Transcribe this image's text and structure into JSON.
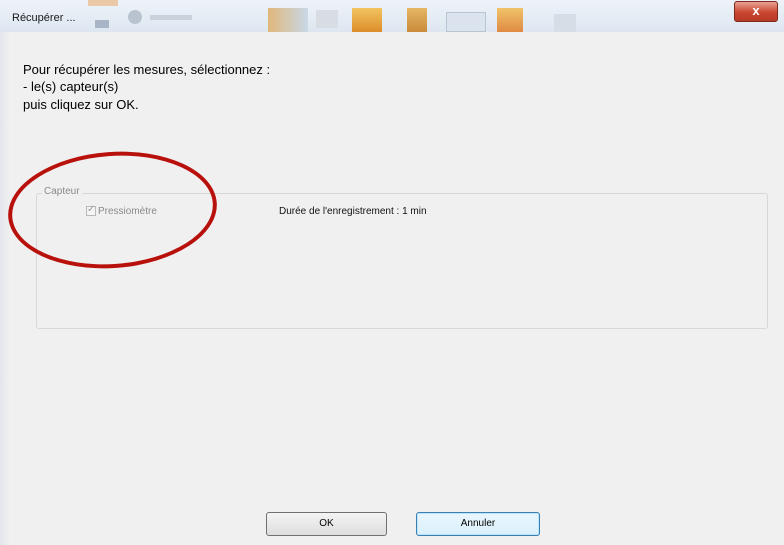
{
  "window": {
    "title": "Récupérer ...",
    "close_label": "x"
  },
  "instructions": {
    "line1": "Pour récupérer les mesures, sélectionnez :",
    "line2": "- le(s) capteur(s)",
    "line3": "puis cliquez sur OK."
  },
  "group": {
    "legend": "Capteur",
    "sensor_label": "Pressiomètre",
    "sensor_checked": true,
    "check_glyph": "✓",
    "duration": "Durée de l'enregistrement : 1 min"
  },
  "buttons": {
    "ok": "OK",
    "cancel": "Annuler"
  },
  "colors": {
    "annotation": "#b8110c",
    "close_button": "#c9452f"
  }
}
